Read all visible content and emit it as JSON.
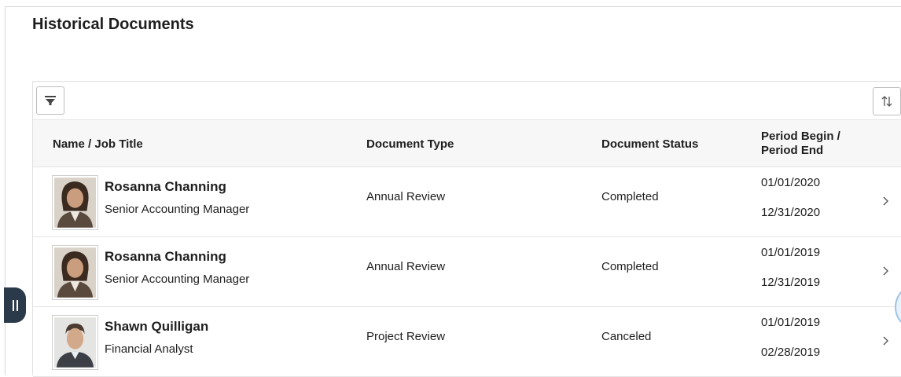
{
  "page": {
    "title": "Historical Documents"
  },
  "toolbar": {
    "filter_icon": "filter-icon",
    "sort_icon": "sort-icon"
  },
  "columns": {
    "name": "Name / Job Title",
    "type": "Document Type",
    "status": "Document Status",
    "period_begin": "Period Begin /",
    "period_end": "Period End"
  },
  "rows": [
    {
      "name": "Rosanna Channing",
      "job_title": "Senior Accounting Manager",
      "document_type": "Annual Review",
      "document_status": "Completed",
      "period_begin": "01/01/2020",
      "period_end": "12/31/2020"
    },
    {
      "name": "Rosanna Channing",
      "job_title": "Senior Accounting Manager",
      "document_type": "Annual Review",
      "document_status": "Completed",
      "period_begin": "01/01/2019",
      "period_end": "12/31/2019"
    },
    {
      "name": "Shawn Quilligan",
      "job_title": "Financial Analyst",
      "document_type": "Project Review",
      "document_status": "Canceled",
      "period_begin": "01/01/2019",
      "period_end": "02/28/2019"
    }
  ],
  "colors": {
    "header_bg": "#f7f7f7",
    "handle": "#2b3a4a",
    "border": "#e4e4e4"
  }
}
